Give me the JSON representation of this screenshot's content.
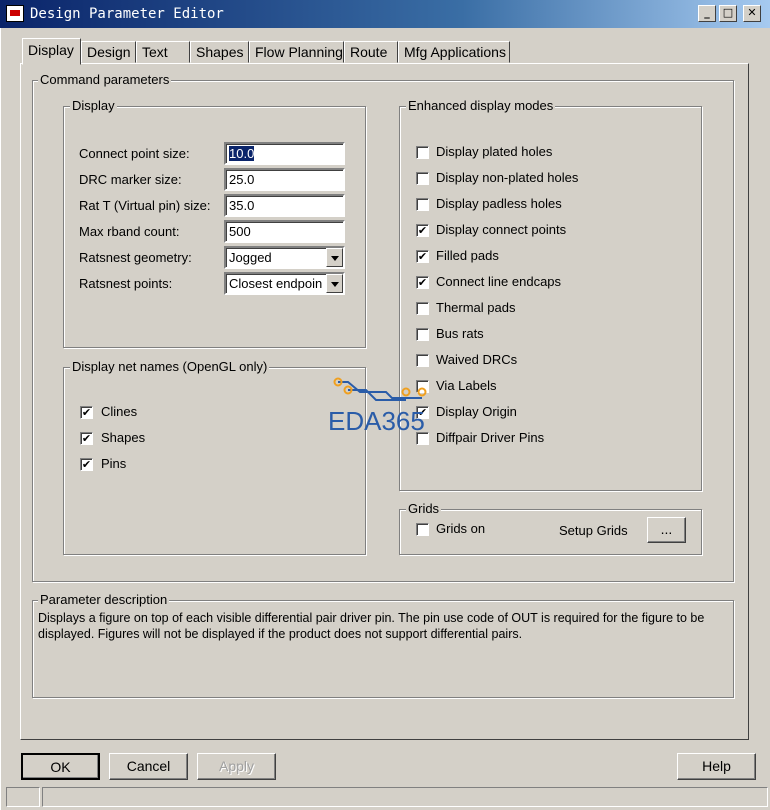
{
  "window": {
    "title": "Design Parameter Editor",
    "controls": {
      "minimize": "_",
      "maximize": "□",
      "close": "✕"
    }
  },
  "tabs": [
    "Display",
    "Design",
    "Text",
    "Shapes",
    "Flow Planning",
    "Route",
    "Mfg Applications"
  ],
  "active_tab": "Display",
  "command_parameters": {
    "legend": "Command parameters",
    "display": {
      "legend": "Display",
      "fields": [
        {
          "label": "Connect point size:",
          "value": "10.0"
        },
        {
          "label": "DRC marker size:",
          "value": "25.0"
        },
        {
          "label": "Rat T (Virtual pin) size:",
          "value": "35.0"
        },
        {
          "label": "Max rband count:",
          "value": "500"
        }
      ],
      "selects": [
        {
          "label": "Ratsnest geometry:",
          "value": "Jogged"
        },
        {
          "label": "Ratsnest points:",
          "value": "Closest endpoin"
        }
      ]
    },
    "net_names": {
      "legend": "Display net names (OpenGL only)",
      "items": [
        {
          "label": "Clines",
          "checked": true
        },
        {
          "label": "Shapes",
          "checked": true
        },
        {
          "label": "Pins",
          "checked": true
        }
      ]
    },
    "enhanced": {
      "legend": "Enhanced display modes",
      "items": [
        {
          "label": "Display plated holes",
          "checked": false
        },
        {
          "label": "Display non-plated holes",
          "checked": false
        },
        {
          "label": "Display padless holes",
          "checked": false
        },
        {
          "label": "Display connect points",
          "checked": true
        },
        {
          "label": "Filled pads",
          "checked": true
        },
        {
          "label": "Connect line endcaps",
          "checked": true
        },
        {
          "label": "Thermal pads",
          "checked": false
        },
        {
          "label": "Bus rats",
          "checked": false
        },
        {
          "label": "Waived DRCs",
          "checked": false
        },
        {
          "label": "Via Labels",
          "checked": false
        },
        {
          "label": "Display Origin",
          "checked": true
        },
        {
          "label": "Diffpair Driver Pins",
          "checked": false
        }
      ]
    },
    "grids": {
      "legend": "Grids",
      "grids_on": {
        "label": "Grids on",
        "checked": false
      },
      "setup_label": "Setup Grids",
      "setup_button": "..."
    }
  },
  "parameter_description": {
    "legend": "Parameter description",
    "text": "Displays a figure on top of each visible differential pair driver pin.  The pin use code of OUT is required for the figure to be displayed.  Figures will not be displayed if the product does not support differential pairs."
  },
  "buttons": {
    "ok": "OK",
    "cancel": "Cancel",
    "apply": "Apply",
    "help": "Help"
  },
  "watermark": {
    "text": "EDA365"
  },
  "check_mark": "✔",
  "colors": {
    "titlebar": "#0a246a",
    "face": "#d4d0c8",
    "selection": "#0a246a",
    "watermark_blue": "#2a5ca8",
    "watermark_orange": "#f0a020"
  }
}
